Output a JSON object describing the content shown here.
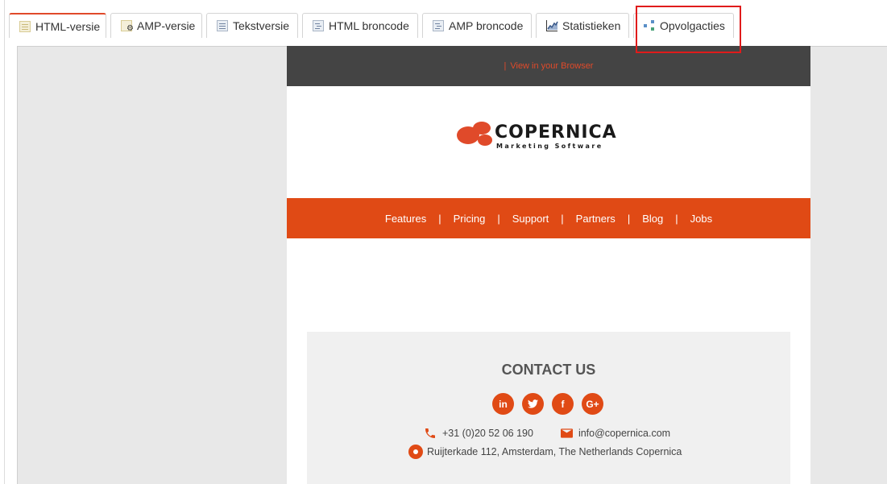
{
  "tabs": [
    {
      "label": "HTML-versie",
      "icon": "html-version-icon",
      "active": true
    },
    {
      "label": "AMP-versie",
      "icon": "amp-version-icon",
      "active": false
    },
    {
      "label": "Tekstversie",
      "icon": "text-version-icon",
      "active": false
    },
    {
      "label": "HTML broncode",
      "icon": "html-source-icon",
      "active": false
    },
    {
      "label": "AMP broncode",
      "icon": "amp-source-icon",
      "active": false
    },
    {
      "label": "Statistieken",
      "icon": "statistics-icon",
      "active": false
    },
    {
      "label": "Opvolgacties",
      "icon": "followup-icon",
      "active": false,
      "highlighted": true
    }
  ],
  "email": {
    "topbar": {
      "separator": "|",
      "view_in_browser": "View in your Browser"
    },
    "logo": {
      "name": "COPERNICA",
      "tagline": "Marketing Software"
    },
    "nav": [
      {
        "label": "Features"
      },
      {
        "label": "Pricing"
      },
      {
        "label": "Support"
      },
      {
        "label": "Partners"
      },
      {
        "label": "Blog"
      },
      {
        "label": "Jobs"
      }
    ],
    "nav_separator": "|",
    "contact": {
      "title": "CONTACT US",
      "socials": [
        {
          "glyph": "in",
          "icon": "linkedin-icon"
        },
        {
          "glyph": "🐦",
          "icon": "twitter-icon"
        },
        {
          "glyph": "f",
          "icon": "facebook-icon"
        },
        {
          "glyph": "G+",
          "icon": "google-plus-icon"
        }
      ],
      "phone": "+31 (0)20 52 06 190",
      "email": "info@copernica.com",
      "address": "Ruijterkade 112, Amsterdam, The Netherlands Copernica"
    }
  },
  "colors": {
    "accent": "#e04a15",
    "topbar": "#444444",
    "highlight": "#e01b1b"
  }
}
